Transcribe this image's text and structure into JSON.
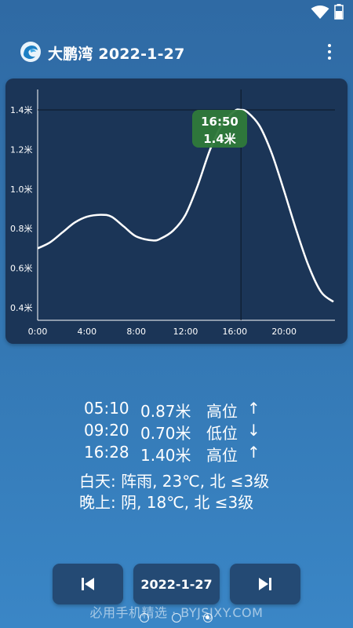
{
  "status_bar": {
    "icons": [
      "wifi-icon",
      "battery-icon"
    ]
  },
  "header": {
    "logo_icon": "wave-logo-icon",
    "title": "大鹏湾 2022-1-27",
    "menu_icon": "more-vert-icon"
  },
  "chart_data": {
    "type": "line",
    "title": "",
    "xlabel": "",
    "ylabel": "",
    "x_ticks": [
      "0:00",
      "4:00",
      "8:00",
      "12:00",
      "16:00",
      "20:00"
    ],
    "y_ticks": [
      "0.4米",
      "0.6米",
      "0.8米",
      "1.0米",
      "1.2米",
      "1.4米"
    ],
    "xlim": [
      0,
      24
    ],
    "ylim": [
      0.4,
      1.4
    ],
    "grid": false,
    "series": [
      {
        "x": [
          0,
          1,
          2,
          3,
          4,
          5.17,
          6,
          7,
          8,
          9.33,
          10,
          11,
          12,
          13,
          14,
          15,
          16,
          16.47,
          17,
          18,
          19,
          20,
          21,
          22,
          23,
          24
        ],
        "y": [
          0.7,
          0.73,
          0.78,
          0.83,
          0.86,
          0.87,
          0.86,
          0.81,
          0.76,
          0.74,
          0.75,
          0.79,
          0.87,
          1.02,
          1.2,
          1.33,
          1.395,
          1.4,
          1.39,
          1.32,
          1.18,
          0.99,
          0.79,
          0.61,
          0.48,
          0.43
        ]
      }
    ],
    "crosshair": {
      "x": 16.5,
      "y": 1.4
    },
    "tooltip": {
      "time": "16:50",
      "value": "1.4米"
    }
  },
  "tides": [
    {
      "time": "05:10",
      "height": "0.87米",
      "type": "高位",
      "arrow": "↑"
    },
    {
      "time": "09:20",
      "height": "0.70米",
      "type": "低位",
      "arrow": "↓"
    },
    {
      "time": "16:28",
      "height": "1.40米",
      "type": "高位",
      "arrow": "↑"
    }
  ],
  "weather": {
    "day": "白天: 阵雨, 23℃, 北 ≤3级",
    "night": "晚上: 阴, 18℃, 北 ≤3级"
  },
  "navigation": {
    "prev_icon": "skip-previous-icon",
    "date_label": "2022-1-27",
    "next_icon": "skip-next-icon"
  },
  "watermark": "必用手机精选 · BYJSJXY.COM",
  "page_indicator": {
    "count": 3,
    "active": 3
  }
}
